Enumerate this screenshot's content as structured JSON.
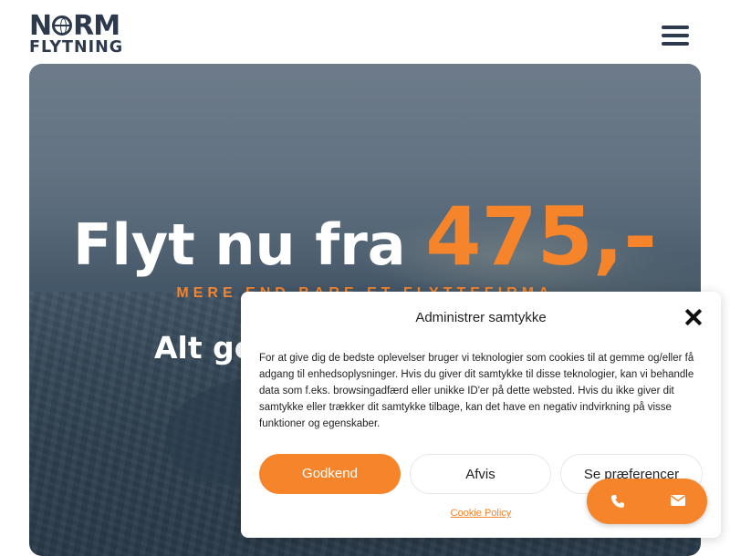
{
  "header": {
    "logo_top": "NORM",
    "logo_bottom": "FLYTNING",
    "menu_icon": "hamburger-icon"
  },
  "hero": {
    "headline_prefix": "Flyt nu fra",
    "headline_price": "475,-",
    "tagline": "MERE END BARE ET FLYTTEFIRMA",
    "subline": "Alt go"
  },
  "consent": {
    "title": "Administrer samtykke",
    "body": "For at give dig de bedste oplevelser bruger vi teknologier som cookies til at gemme og/eller få adgang til enhedsoplysninger. Hvis du giver dit samtykke til disse teknologier, kan vi behandle data som f.eks. browsingadfærd eller unikke ID'er på dette websted. Hvis du ikke giver dit samtykke eller trækker dit samtykke tilbage, kan det have en negativ indvirkning på visse funktioner og egenskaber.",
    "accept_label": "Godkend",
    "deny_label": "Afvis",
    "prefs_label": "Se præferencer",
    "policy_link": "Cookie Policy",
    "close_icon": "close-icon"
  },
  "contact": {
    "phone_icon": "phone-icon",
    "mail_icon": "mail-icon"
  },
  "colors": {
    "brand_dark": "#2d3a4e",
    "accent": "#f5842b"
  }
}
